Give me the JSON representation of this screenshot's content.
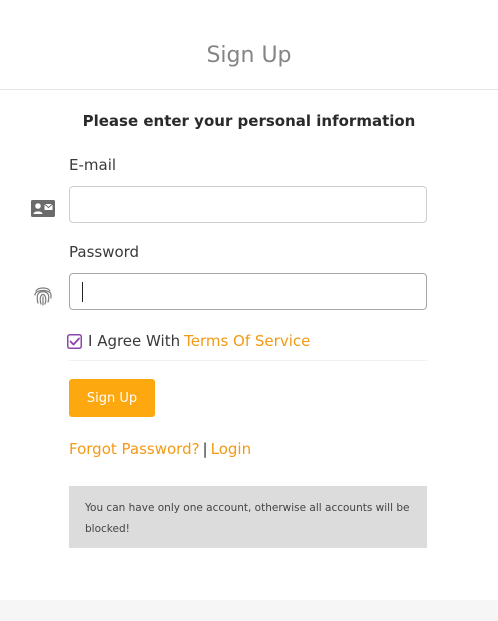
{
  "header": {
    "title": "Sign Up"
  },
  "form": {
    "subtitle": "Please enter your personal information",
    "email_label": "E-mail",
    "email_value": "",
    "password_label": "Password",
    "password_value": "",
    "agree_text": "I Agree With",
    "terms_link": "Terms Of Service",
    "agree_checked": true,
    "submit_label": "Sign Up",
    "forgot_link": "Forgot Password?",
    "separator": "|",
    "login_link": "Login",
    "notice": "You can have only one account, otherwise all accounts will be blocked!"
  },
  "icons": {
    "email": "contact-card-icon",
    "password": "fingerprint-icon",
    "checkbox": "checkbox-checked-icon"
  },
  "colors": {
    "accent": "#fea80f",
    "link": "#f39a14",
    "checkbox": "#8e44ad",
    "notice_bg": "#dcdcdc"
  }
}
